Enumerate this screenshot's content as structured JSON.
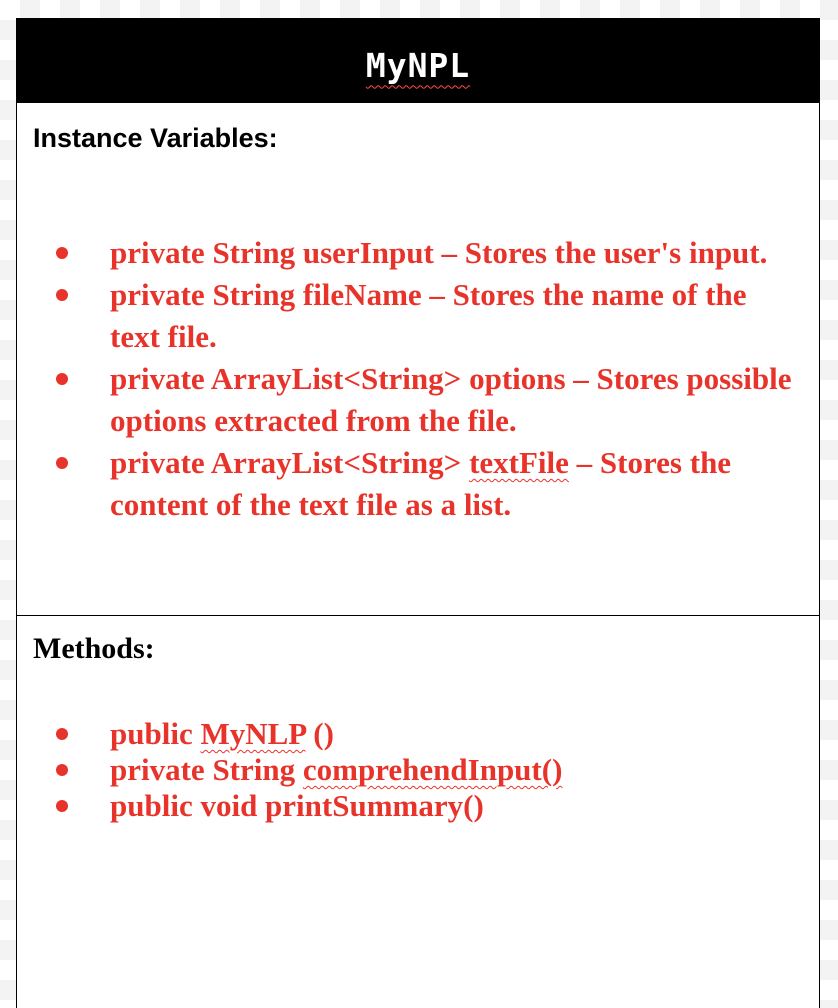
{
  "header": {
    "title": "MyNPL"
  },
  "instance_variables": {
    "heading": "Instance Variables:",
    "items": [
      {
        "before": "private String userInput – Stores the user's input.",
        "marked": "",
        "after": ""
      },
      {
        "before": "private String fileName – Stores the name of the text file.",
        "marked": "",
        "after": ""
      },
      {
        "before": "private ArrayList<String> options – Stores possible options extracted from the file.",
        "marked": "",
        "after": ""
      },
      {
        "before": "private ArrayList<String> ",
        "marked": "textFile",
        "after": " – Stores the content of the text file as a list."
      }
    ]
  },
  "methods": {
    "heading": "Methods:",
    "items": [
      {
        "before": "public ",
        "marked": "MyNLP",
        "after": " ()"
      },
      {
        "before": "private String ",
        "marked": "comprehendInput()",
        "after": ""
      },
      {
        "before": "public void printSummary()",
        "marked": "",
        "after": ""
      }
    ]
  },
  "colors": {
    "header_background": "#000000",
    "header_text": "#ffffff",
    "item_text": "#e8332a",
    "heading_text": "#000000",
    "border": "#000000"
  }
}
